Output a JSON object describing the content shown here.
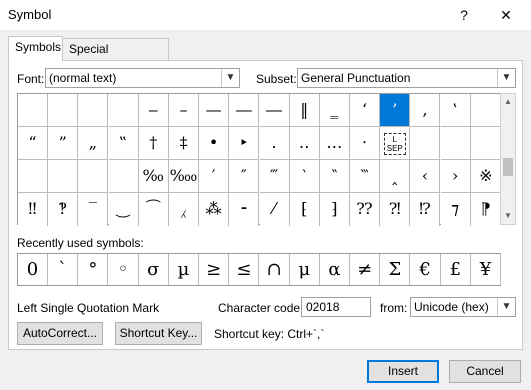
{
  "window": {
    "title": "Symbol",
    "help": "?",
    "close": "✕"
  },
  "tabs": [
    {
      "label": "Symbols"
    },
    {
      "label": "Special Characters"
    }
  ],
  "font": {
    "label": "Font:",
    "value": "(normal text)"
  },
  "subset": {
    "label": "Subset:",
    "value": "General Punctuation"
  },
  "grid": [
    [
      "",
      "",
      "",
      "",
      "‒",
      "–",
      "—",
      "―",
      "―",
      "‖",
      "‗",
      "‘",
      "’",
      "‚",
      "‛"
    ],
    [
      "“",
      "”",
      "„",
      "‟",
      "†",
      "‡",
      "•",
      "‣",
      "․",
      "‥",
      "…",
      "‧",
      "SEP",
      "",
      ""
    ],
    [
      "",
      "",
      "",
      "",
      "‰",
      "‱",
      "′",
      "″",
      "‴",
      "‵",
      "‶",
      "‷",
      "‸",
      "‹",
      "›",
      "※"
    ],
    [
      "‼",
      "‽",
      "‾",
      "‿",
      "⁀",
      "⁁",
      "⁂",
      "⁃",
      "⁄",
      "⁅",
      "⁆",
      "⁇",
      "⁈",
      "⁉",
      "⁊",
      "⁋"
    ]
  ],
  "selected": {
    "row": 0,
    "col": 12
  },
  "recent": {
    "label": "Recently used symbols:",
    "items": [
      "0",
      "`",
      "°",
      "◦",
      "σ",
      "µ",
      "≥",
      "≤",
      "∩",
      "μ",
      "α",
      "≠",
      "Σ",
      "€",
      "£",
      "¥"
    ]
  },
  "char_name": "Left Single Quotation Mark",
  "char_code": {
    "label": "Character code:",
    "value": "02018"
  },
  "from": {
    "label": "from:",
    "value": "Unicode (hex)"
  },
  "buttons": {
    "autocorrect": "AutoCorrect...",
    "shortcut_key": "Shortcut Key...",
    "insert": "Insert",
    "cancel": "Cancel"
  },
  "shortcut_text": "Shortcut key: Ctrl+`,`",
  "colors": {
    "selection": "#0078d7"
  }
}
